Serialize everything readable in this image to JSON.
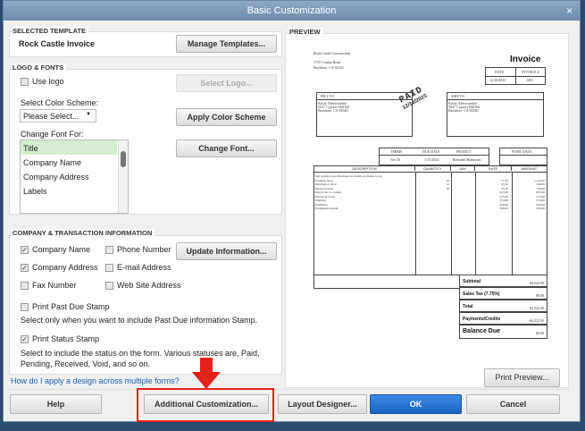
{
  "window": {
    "title": "Basic Customization",
    "close": "×"
  },
  "selected_template": {
    "heading": "SELECTED TEMPLATE",
    "name": "Rock Castle Invoice",
    "manage": "Manage Templates..."
  },
  "logo_fonts": {
    "heading": "LOGO & FONTS",
    "use_logo": "Use logo",
    "use_logo_checked": false,
    "select_logo": "Select Logo...",
    "color_label": "Select Color Scheme:",
    "color_value": "Please Select...",
    "apply_color": "Apply Color Scheme",
    "font_label": "Change Font For:",
    "font_items": [
      "Title",
      "Company Name",
      "Company Address",
      "Labels"
    ],
    "selected_font_item": "Title",
    "change_font": "Change Font..."
  },
  "company": {
    "heading": "COMPANY & TRANSACTION INFORMATION",
    "fields": [
      {
        "label": "Company Name",
        "checked": true
      },
      {
        "label": "Phone Number",
        "checked": false
      },
      {
        "label": "Company Address",
        "checked": true
      },
      {
        "label": "E-mail Address",
        "checked": false
      },
      {
        "label": "Fax Number",
        "checked": false
      },
      {
        "label": "Web Site Address",
        "checked": false
      }
    ],
    "update": "Update Information...",
    "past_due": "Print Past Due Stamp",
    "past_due_note": "Select only when you want to include Past Due information Stamp.",
    "status": "Print Status Stamp",
    "status_note": "Select to include the status on the form. Various statuses are, Paid, Pending, Received, Void, and so on."
  },
  "help_link": "How do I apply a design across multiple forms?",
  "preview": {
    "heading": "PREVIEW",
    "print_preview": "Print Preview...",
    "invoice": {
      "company": "Rock Castle Construction",
      "addr1": "1735 County Road",
      "addr2": "Bayshore, CA 94326",
      "title": "Invoice",
      "date_h": "DATE",
      "inv_h": "INVOICE #",
      "date": "12/16/2023",
      "inv_no": "1001",
      "stamp": "PAID",
      "stamp_date": "12/16/2023",
      "bill_to_h": "BILL TO",
      "ship_to_h": "SHIP TO",
      "bill_to": [
        "Kristy Abercrombie",
        "5647 Cypress Hill Rd",
        "Bayshore, CA 94326"
      ],
      "ship_to": [
        "Kristy Abercrombie",
        "5647 Cypress Hill Rd",
        "Bayshore, CA 94326"
      ],
      "terms_h": "TERMS",
      "due_h": "DUE DATE",
      "project_h": "PROJECT",
      "pymt_h": "PYMT DATE",
      "terms": "Net 30",
      "due": "1/15/2024",
      "project": "Remodel Bathroom",
      "cols": [
        "DESCRIPTION",
        "QUANTITY",
        "U/M",
        "RATE",
        "AMOUNT"
      ],
      "lines": [
        {
          "d": "See attached specifications for details on future work.",
          "q": "",
          "r": "",
          "a": ""
        },
        {
          "d": "Framing labor",
          "q": "16",
          "r": "71.50",
          "a": "1,144.00"
        },
        {
          "d": "Installation labor",
          "q": "12",
          "r": "45.50",
          "a": "546.00"
        },
        {
          "d": "Removal labor",
          "q": "16",
          "r": "45.50",
          "a": "728.00"
        },
        {
          "d": "Install tile or counter",
          "q": "",
          "r": "825.00",
          "a": "825.00"
        },
        {
          "d": "Electrical work",
          "q": "",
          "r": "275.00",
          "a": "275.00"
        },
        {
          "d": "Painting",
          "q": "",
          "r": "374.00",
          "a": "374.00"
        },
        {
          "d": "Plumbing",
          "q": "",
          "r": "950.00",
          "a": "950.00"
        },
        {
          "d": "Equipment Rental",
          "q": "",
          "r": "500.00",
          "a": "500.00"
        }
      ],
      "totals": [
        {
          "label": "Subtotal",
          "value": "$4,522.00"
        },
        {
          "label": "Sales Tax  (7.75%)",
          "value": "$0.00"
        },
        {
          "label": "Total",
          "value": "$4,522.00"
        },
        {
          "label": "Payments/Credits",
          "value": "-$4,522.00"
        },
        {
          "label": "Balance Due",
          "value": "$0.00"
        }
      ]
    }
  },
  "buttons": {
    "help": "Help",
    "additional": "Additional Customization...",
    "layout": "Layout Designer...",
    "ok": "OK",
    "cancel": "Cancel"
  },
  "colors": {
    "highlight": "#e3221b",
    "ok": "#1d6fd1",
    "selected_item": "#d5ecd0"
  }
}
